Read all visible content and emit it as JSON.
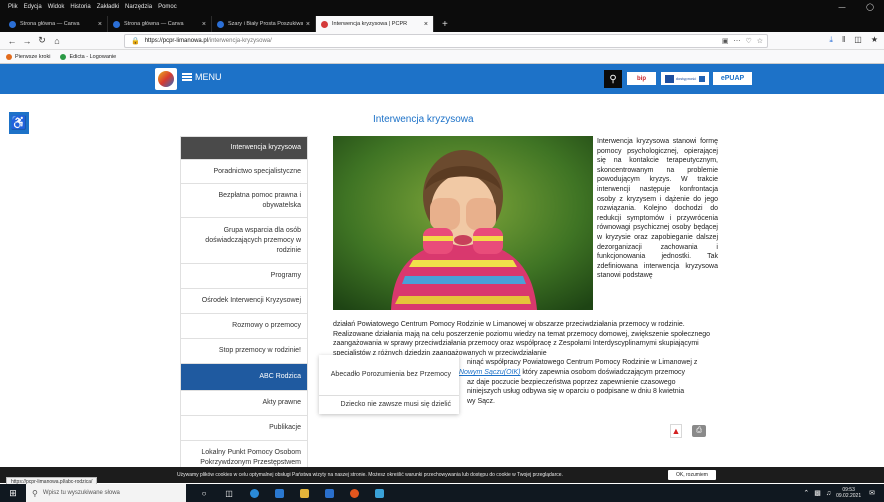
{
  "browser": {
    "menu": [
      "Plik",
      "Edycja",
      "Widok",
      "Historia",
      "Zakładki",
      "Narzędzia",
      "Pomoc"
    ],
    "tabs": [
      {
        "title": "Strona główna — Canva",
        "active": false
      },
      {
        "title": "Strona główna — Canva",
        "active": false
      },
      {
        "title": "Szary i Biały Prosta Poszukiwan",
        "active": false
      },
      {
        "title": "Interwencja kryzysowa | PCPR",
        "active": true
      }
    ],
    "url_host": "https://pcpr-limanowa.pl",
    "url_path": "/interwencja-kryzysowa/",
    "bookmarks": [
      "Pierwsze kroki",
      "Edicta - Logowanie"
    ]
  },
  "header": {
    "menu_label": "MENU",
    "bip_label": "bip",
    "dostepnosc_label": "dostępność",
    "epuap_label": "ePUAP"
  },
  "page": {
    "title": "Interwencja kryzysowa",
    "text_right": "Interwencja kryzysowa stanowi formę pomocy psychologicznej, opierającej się na kontakcie terapeutycznym, skoncentrowanym na problemie powodującym kryzys. W trakcie interwencji następuje konfrontacja osoby z kryzysem i dążenie do jego rozwiązania. Kolejno dochodzi do redukcji symptomów i przywrócenia równowagi psychicznej osoby będącej w kryzysie oraz zapobieganie dalszej dezorganizacji zachowania i funkcjonowania jednostki. Tak zdefiniowana interwencja kryzysowa stanowi podstawę",
    "text_bottom_1": "działań Powiatowego Centrum Pomocy Rodzinie w Limanowej w obszarze przeciwdziałania przemocy w rodzinie. Realizowane działania mają na celu poszerzenie poziomu wiedzy na temat przemocy domowej, zwiększenie społecznego zaangażowania w sprawy przeciwdziałania przemocy oraz współpracę z Zespołami Interdyscyplinarnymi skupiającymi specjalistów z różnych dziedzin zaangażowanych w przeciwdziałanie",
    "text_bottom_2": "ninąć współpracy Powiatowego Centrum Pomocy Rodzinie w Limanowej z",
    "text_bottom_link": "Nowym Sączu(OIK)",
    "text_bottom_3": "który zapewnia osobom doświadczającym przemocy",
    "text_bottom_4": "az daje poczucie bezpieczeństwa poprzez zapewnienie czasowego",
    "text_bottom_5": "niniejszych usług odbywa się w oparciu o podpisane w dniu 8 kwietnia",
    "text_bottom_6": "wy Sącz."
  },
  "sidebar": {
    "items": [
      {
        "label": "Interwencja kryzysowa",
        "style": "dark"
      },
      {
        "label": "Poradnictwo specjalistyczne",
        "style": ""
      },
      {
        "label": "Bezpłatna pomoc prawna i obywatelska",
        "style": ""
      },
      {
        "label": "Grupa wsparcia dla osób doświadczających przemocy w rodzinie",
        "style": ""
      },
      {
        "label": "Programy",
        "style": ""
      },
      {
        "label": "Ośrodek Interwencji Kryzysowej",
        "style": ""
      },
      {
        "label": "Rozmowy o przemocy",
        "style": ""
      },
      {
        "label": "Stop przemocy w rodzinie!",
        "style": ""
      },
      {
        "label": "ABC Rodzica",
        "style": "blue"
      },
      {
        "label": "Akty prawne",
        "style": ""
      },
      {
        "label": "Publikacje",
        "style": ""
      },
      {
        "label": "Lokalny Punkt Pomocy Osobom Pokrzywdzonym Przestępstwem",
        "style": ""
      }
    ]
  },
  "dropdown": {
    "items": [
      "Abecadło Porozumienia bez Przemocy",
      "Dziecko nie zawsze musi się dzielić"
    ]
  },
  "cookie": {
    "text": "Używamy plików cookies w celu optymalnej obsługi Państwa wizyty na naszej stronie. Możesz określić warunki przechowywania lub dostępu do cookie w Twojej przeglądarce.",
    "ok_label": "OK, rozumiem"
  },
  "status_url": "https://pcpr-limanowa.pl/abc-rodzica/",
  "taskbar": {
    "search_placeholder": "Wpisz tu wyszukiwane słowa",
    "time": "09:53",
    "date": "09.02.2021"
  }
}
